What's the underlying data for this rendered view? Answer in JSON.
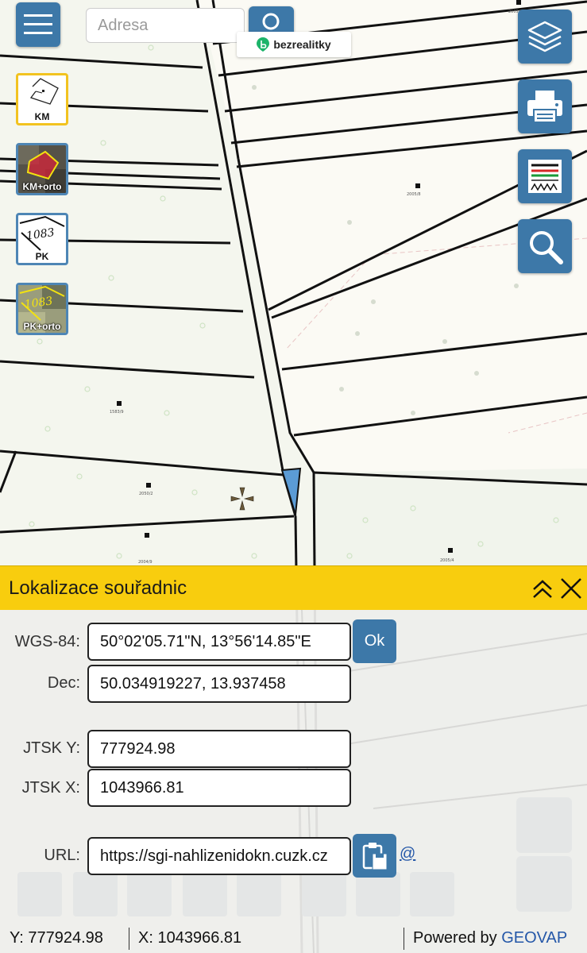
{
  "search": {
    "placeholder": "Adresa"
  },
  "brand": {
    "label": "bezrealitky",
    "color": "#1db46a"
  },
  "layers": [
    {
      "label": "KM",
      "active": true
    },
    {
      "label": "KM+orto",
      "active": false
    },
    {
      "label": "PK",
      "active": false
    },
    {
      "label": "PK+orto",
      "active": false
    }
  ],
  "map": {
    "parcel_labels": [
      "2005/8",
      "1583/9",
      "2050/2",
      "2004/9",
      "2005/4",
      "2005/1"
    ],
    "overlay_values": [
      "1083",
      "1083"
    ]
  },
  "panel": {
    "title": "Lokalizace souřadnic",
    "wgs84_label": "WGS-84:",
    "wgs84_value": "50°02'05.71\"N, 13°56'14.85\"E",
    "dec_label": "Dec:",
    "dec_value": "50.034919227, 13.937458",
    "jtsk_y_label": "JTSK Y:",
    "jtsk_y_value": "777924.98",
    "jtsk_x_label": "JTSK X:",
    "jtsk_x_value": "1043966.81",
    "url_label": "URL:",
    "url_value": "https://sgi-nahlizenidokn.cuzk.cz",
    "ok_label": "Ok",
    "email_label": "@"
  },
  "status": {
    "y_text": "Y: 777924.98",
    "x_text": "X: 1043966.81",
    "powered_prefix": "Powered by",
    "powered_brand": "GEOVAP"
  },
  "colors": {
    "accent_blue": "#3d78a8",
    "panel_header": "#f8cd0e",
    "active_layer": "#f2c320",
    "parcel_highlight": "#5b9bd5"
  }
}
